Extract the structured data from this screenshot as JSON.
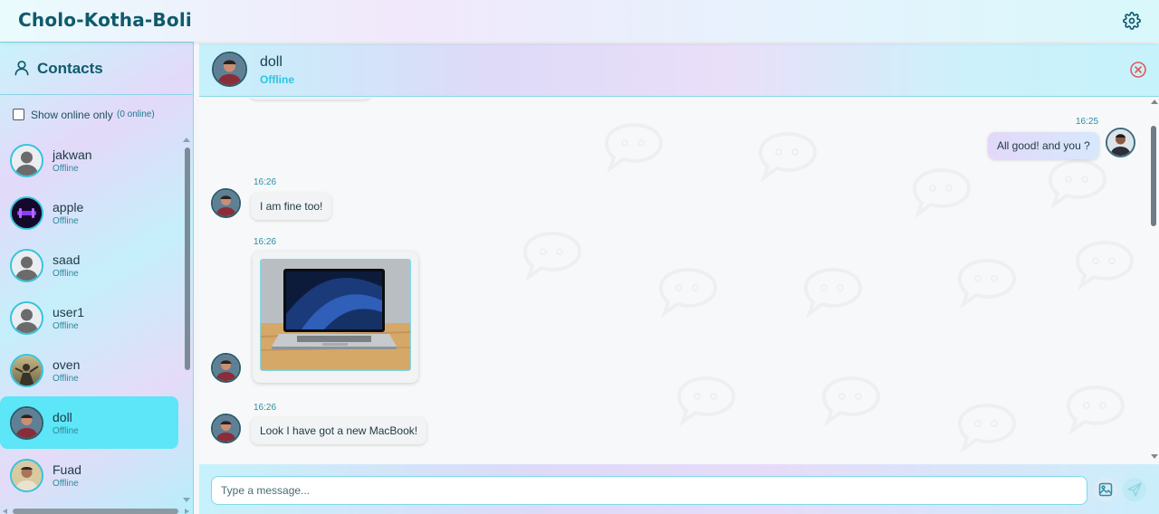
{
  "app": {
    "title": "Cholo-Kotha-Boli",
    "settings_icon": "gear-icon"
  },
  "sidebar": {
    "title": "Contacts",
    "filter_label": "Show online only",
    "online_count": "(0 online)",
    "contacts": [
      {
        "name": "jakwan",
        "status": "Offline",
        "avatar": "default-avatar"
      },
      {
        "name": "apple",
        "status": "Offline",
        "avatar": "neon-avatar"
      },
      {
        "name": "saad",
        "status": "Offline",
        "avatar": "default-avatar"
      },
      {
        "name": "user1",
        "status": "Offline",
        "avatar": "default-avatar"
      },
      {
        "name": "oven",
        "status": "Offline",
        "avatar": "photo-avatar"
      },
      {
        "name": "doll",
        "status": "Offline",
        "avatar": "photo-avatar",
        "active": true
      },
      {
        "name": "Fuad",
        "status": "Offline",
        "avatar": "photo-avatar"
      }
    ]
  },
  "chat": {
    "name": "doll",
    "status": "Offline",
    "messages": [
      {
        "direction": "out",
        "time": "16:25",
        "text": "All good! and you ?"
      },
      {
        "direction": "in",
        "time": "16:26",
        "text": "I am fine too!"
      },
      {
        "direction": "in",
        "time": "16:26",
        "type": "image",
        "image": "laptop-photo"
      },
      {
        "direction": "in",
        "time": "16:26",
        "text": "Look I have got a new MacBook!"
      }
    ]
  },
  "composer": {
    "placeholder": "Type a message...",
    "attach_icon": "image-icon",
    "send_icon": "send-icon"
  },
  "colors": {
    "accent": "#2ac6e2",
    "title": "#0f5a6b",
    "active_contact": "#5ce6f7",
    "close": "#e05a5a"
  }
}
